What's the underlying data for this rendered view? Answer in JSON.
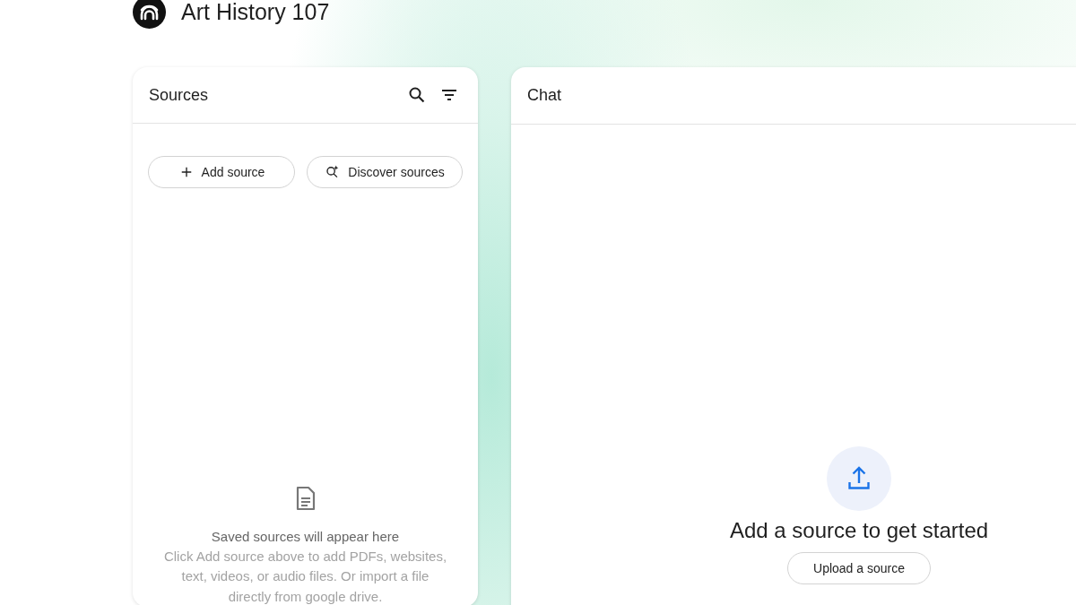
{
  "notebook": {
    "title": "Art History 107"
  },
  "sources_panel": {
    "title": "Sources",
    "buttons": [
      {
        "kind": "add",
        "label": "Add source"
      },
      {
        "kind": "discover",
        "label": "Discover sources"
      }
    ],
    "empty_state": {
      "heading": "Saved sources will appear here",
      "text": "Click Add source above to add PDFs, websites, text, videos, or audio files. Or import a file directly from google drive."
    }
  },
  "chat_panel": {
    "title": "Chat",
    "prompt": "Add a source to get started",
    "button": "Upload a source"
  }
}
